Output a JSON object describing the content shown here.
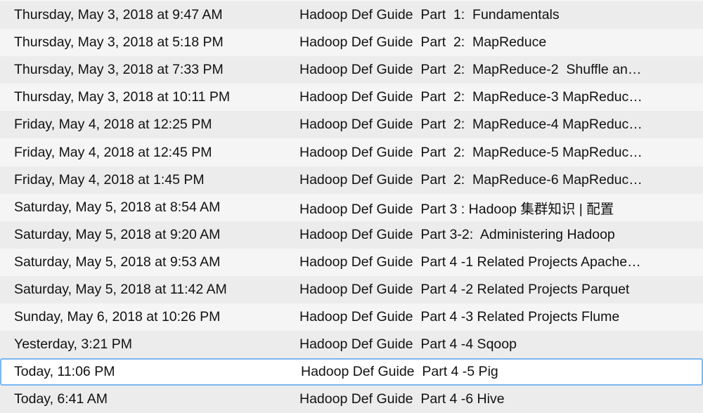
{
  "rows": [
    {
      "date": "Thursday, May 3, 2018 at 9:47 AM",
      "title": "Hadoop Def Guide  Part  1:  Fundamentals"
    },
    {
      "date": "Thursday, May 3, 2018 at 5:18 PM",
      "title": "Hadoop Def Guide  Part  2:  MapReduce"
    },
    {
      "date": "Thursday, May 3, 2018 at 7:33 PM",
      "title": "Hadoop Def Guide  Part  2:  MapReduce-2  Shuffle an…"
    },
    {
      "date": "Thursday, May 3, 2018 at 10:11 PM",
      "title": "Hadoop Def Guide  Part  2:  MapReduce-3 MapReduc…"
    },
    {
      "date": "Friday, May 4, 2018 at 12:25 PM",
      "title": "Hadoop Def Guide  Part  2:  MapReduce-4 MapReduc…"
    },
    {
      "date": "Friday, May 4, 2018 at 12:45 PM",
      "title": "Hadoop Def Guide  Part  2:  MapReduce-5 MapReduc…"
    },
    {
      "date": "Friday, May 4, 2018 at 1:45 PM",
      "title": "Hadoop Def Guide  Part  2:  MapReduce-6 MapReduc…"
    },
    {
      "date": "Saturday, May 5, 2018 at 8:54 AM",
      "title": "Hadoop Def Guide  Part 3 : Hadoop 集群知识 | 配置"
    },
    {
      "date": "Saturday, May 5, 2018 at 9:20 AM",
      "title": "Hadoop Def Guide  Part 3-2:  Administering Hadoop"
    },
    {
      "date": "Saturday, May 5, 2018 at 9:53 AM",
      "title": "Hadoop Def Guide  Part 4 -1 Related Projects Apache…"
    },
    {
      "date": "Saturday, May 5, 2018 at 11:42 AM",
      "title": "Hadoop Def Guide  Part 4 -2 Related Projects Parquet"
    },
    {
      "date": "Sunday, May 6, 2018 at 10:26 PM",
      "title": "Hadoop Def Guide  Part 4 -3 Related Projects Flume"
    },
    {
      "date": "Yesterday, 3:21 PM",
      "title": "Hadoop Def Guide  Part 4 -4 Sqoop"
    },
    {
      "date": "Today, 11:06 PM",
      "title": "Hadoop Def Guide  Part 4 -5 Pig"
    },
    {
      "date": "Today, 6:41 AM",
      "title": "Hadoop Def Guide  Part 4 -6 Hive"
    }
  ],
  "selected_index": 13,
  "colors": {
    "selection_border": "#7ab7f0"
  }
}
